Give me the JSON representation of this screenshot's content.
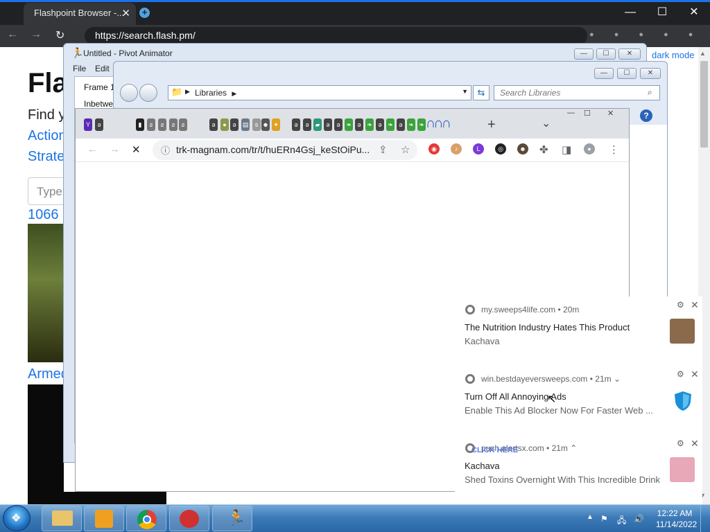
{
  "outer_browser": {
    "tab_title": "Flashpoint Browser -...",
    "tab_close": "✕",
    "newtab": "+",
    "url": "https://search.flash.pm/",
    "window_controls": {
      "minimize": "—",
      "maximize": "☐",
      "close": "✕"
    },
    "nav": {
      "back": "←",
      "forward": "→",
      "reload": "↻"
    }
  },
  "flash_page": {
    "title": "Fla",
    "find_text": "Find y",
    "link_actions": "Action",
    "link_strategy": "Strate",
    "search_placeholder": "Type",
    "result_1": "1066",
    "result_2": "Armed",
    "dark_mode_link": "dark mode"
  },
  "pivot": {
    "title": "Untitled - Pivot Animator",
    "menu": [
      "File",
      "Edit"
    ],
    "frame_label": "Frame 1",
    "inbetween_label": "Inbetwe"
  },
  "libraries": {
    "breadcrumb": "Libraries",
    "search_placeholder": "Search Libraries",
    "help": "?"
  },
  "chrome": {
    "url": "trk-magnam.com/tr/t/huERn4Gsj_keStOiPu...",
    "newtab": "+",
    "dropdown": "⌄",
    "win_controls": {
      "minimize": "—",
      "maximize": "☐",
      "close": "✕"
    }
  },
  "notifications": [
    {
      "source": "my.sweeps4life.com",
      "age": "20m",
      "title": "The Nutrition Industry Hates This Product",
      "body": "Kachava",
      "thumb_color": "#8a6a4a"
    },
    {
      "source": "win.bestdayeversweeps.com",
      "age": "21m",
      "title": "Turn Off All Annoying Ads",
      "body": "Enable This Ad Blocker Now For Faster Web ...",
      "thumb_color": "#1a8fd8"
    },
    {
      "source": "push.alertsx.com",
      "age": "21m",
      "title": "Kachava",
      "body": "Shed Toxins Overnight With This Incredible Drink",
      "overlay": "CLICK HERE",
      "thumb_color": "#e8a8b8"
    }
  ],
  "taskbar": {
    "time": "12:22 AM",
    "date": "11/14/2022"
  }
}
